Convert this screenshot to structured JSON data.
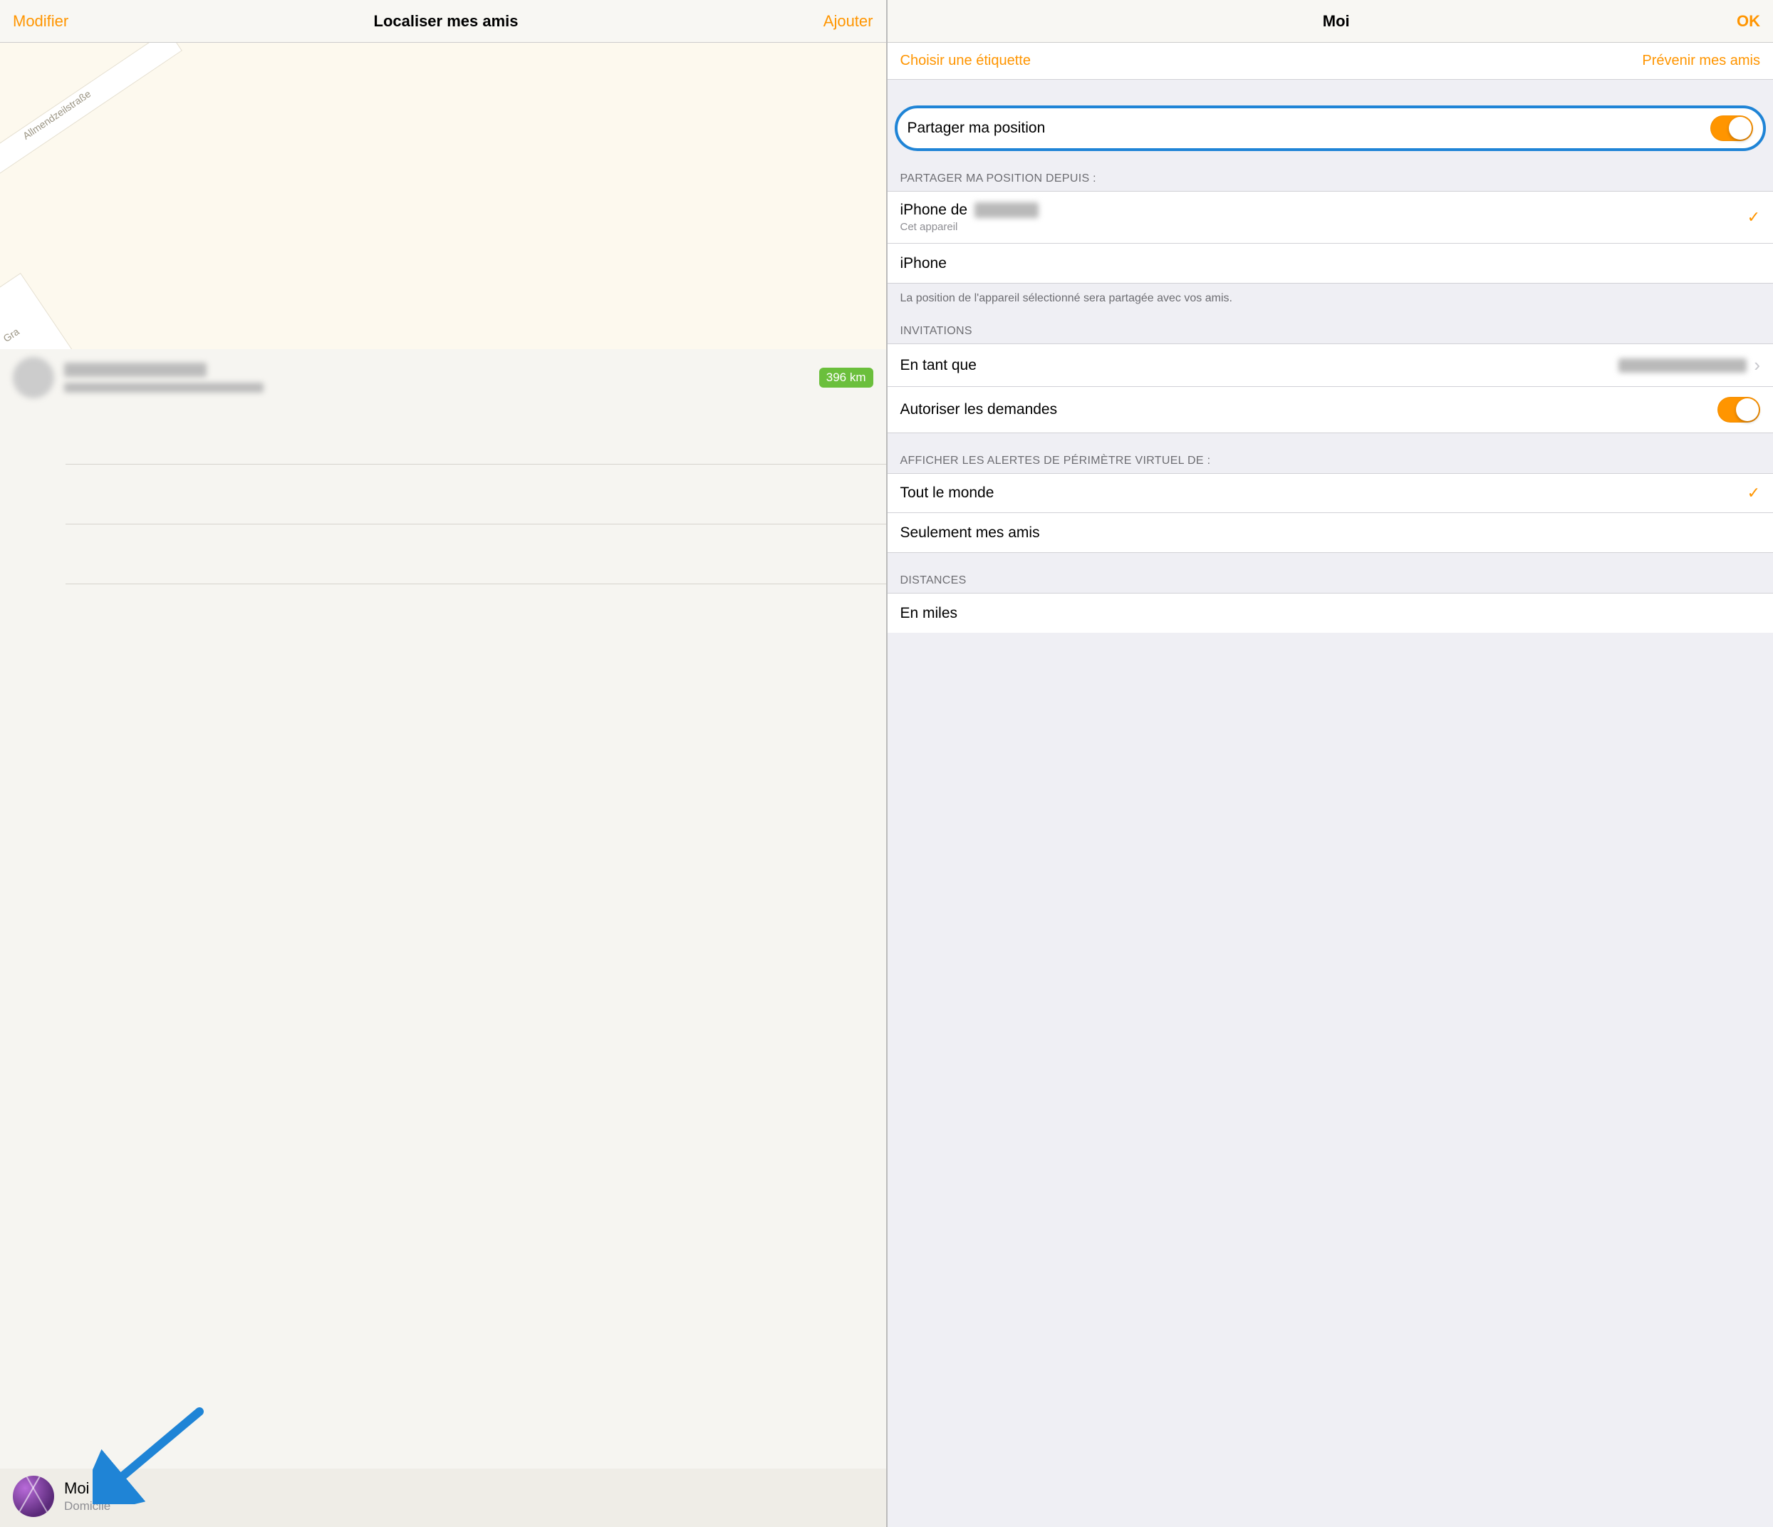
{
  "left": {
    "nav": {
      "left": "Modifier",
      "title": "Localiser mes amis",
      "right": "Ajouter"
    },
    "map": {
      "street1": "Allmendzeilstraße",
      "street2": "Gra"
    },
    "friend": {
      "distance": "396 km"
    },
    "me": {
      "name": "Moi",
      "sub": "Domicile"
    }
  },
  "right": {
    "nav": {
      "title": "Moi",
      "done": "OK"
    },
    "links": {
      "choose_label": "Choisir une étiquette",
      "notify": "Prévenir mes amis"
    },
    "share_row": "Partager ma position",
    "share_from_header": "PARTAGER MA POSITION DEPUIS :",
    "devices": [
      {
        "title_prefix": "iPhone de ",
        "sub": "Cet appareil",
        "selected": true
      },
      {
        "title": "iPhone",
        "selected": false
      }
    ],
    "share_from_footer": "La position de l'appareil sélectionné sera partagée avec vos amis.",
    "invitations_header": "INVITATIONS",
    "as_label": "En tant que",
    "allow_label": "Autoriser les demandes",
    "geofence_header": "AFFICHER LES ALERTES DE PÉRIMÈTRE VIRTUEL DE :",
    "geofence": [
      {
        "label": "Tout le monde",
        "selected": true
      },
      {
        "label": "Seulement mes amis",
        "selected": false
      }
    ],
    "distances_header": "DISTANCES",
    "miles": "En miles"
  }
}
